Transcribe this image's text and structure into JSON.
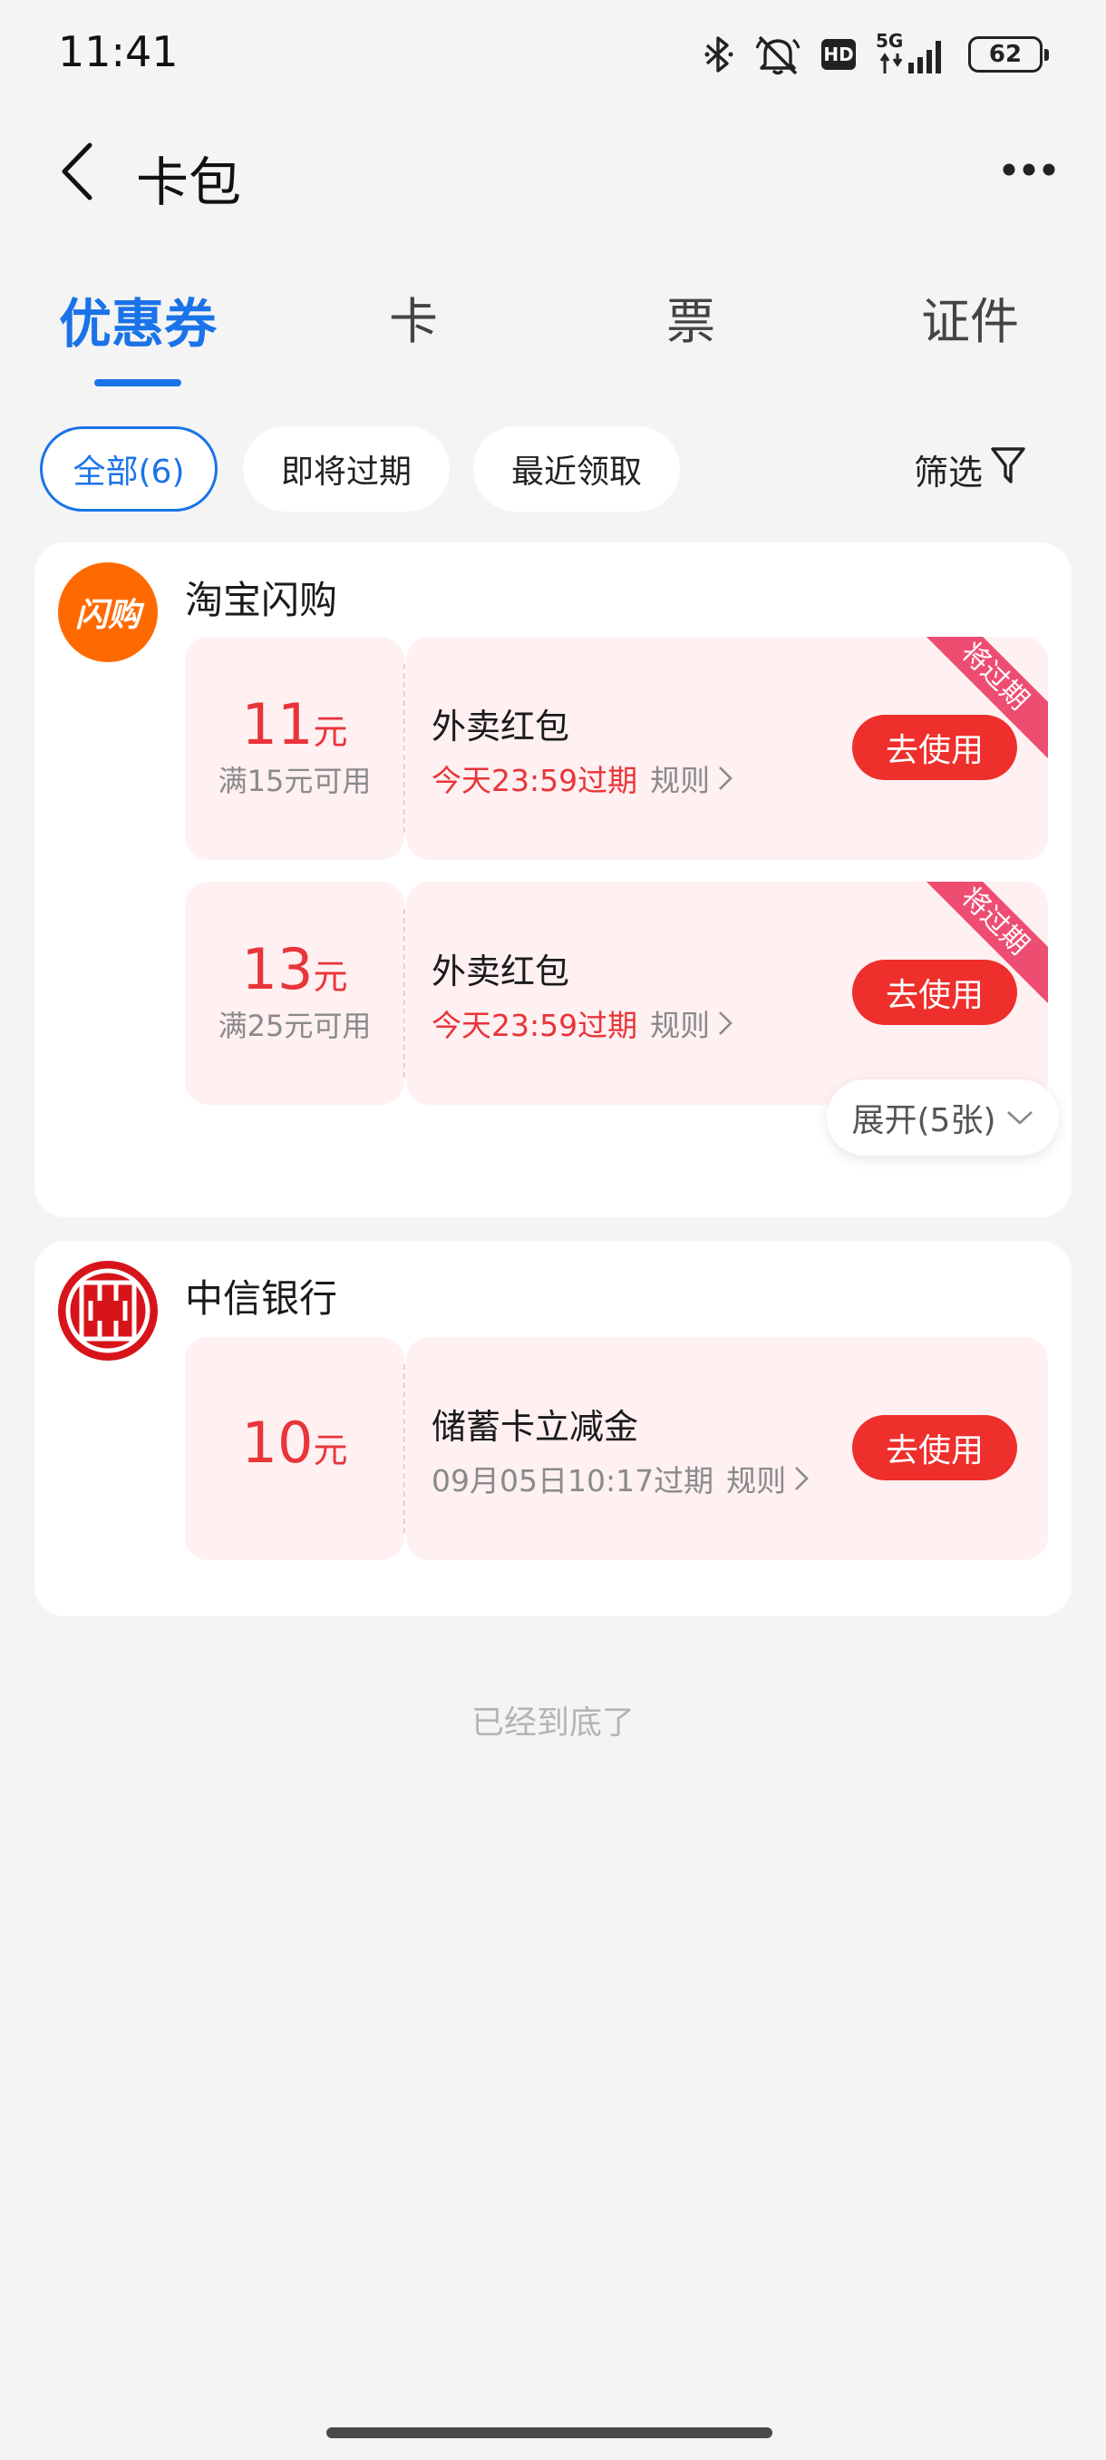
{
  "status_bar": {
    "time": "11:41",
    "network": "5G",
    "hd": "HD",
    "battery": "62"
  },
  "nav": {
    "title": "卡包"
  },
  "tabs": [
    {
      "label": "优惠券",
      "active": true
    },
    {
      "label": "卡",
      "active": false
    },
    {
      "label": "票",
      "active": false
    },
    {
      "label": "证件",
      "active": false
    }
  ],
  "filters": {
    "chips": [
      {
        "label": "全部(6)",
        "active": true
      },
      {
        "label": "即将过期",
        "active": false
      },
      {
        "label": "最近领取",
        "active": false
      }
    ],
    "filter_label": "筛选"
  },
  "merchants": [
    {
      "name": "淘宝闪购",
      "logo_text": "闪购",
      "logo_color": "#ff6a00",
      "coupons": [
        {
          "amount": "11",
          "unit": "元",
          "condition": "满15元可用",
          "title": "外卖红包",
          "expire": "今天23:59过期",
          "rule": "规则",
          "button": "去使用",
          "ribbon": "将过期"
        },
        {
          "amount": "13",
          "unit": "元",
          "condition": "满25元可用",
          "title": "外卖红包",
          "expire": "今天23:59过期",
          "rule": "规则",
          "button": "去使用",
          "ribbon": "将过期"
        }
      ],
      "expand_label": "展开(5张)"
    },
    {
      "name": "中信银行",
      "logo_color": "#d7141a",
      "coupons": [
        {
          "amount": "10",
          "unit": "元",
          "condition": "",
          "title": "储蓄卡立减金",
          "expire": "09月05日10:17过期",
          "rule": "规则",
          "button": "去使用"
        }
      ]
    }
  ],
  "footer": {
    "end_text": "已经到底了"
  },
  "colors": {
    "accent": "#1a73e8",
    "coupon_red": "#e8353a",
    "button_red": "#ee2f2b",
    "ribbon_pink": "#ee4d72",
    "coupon_bg": "#fff0f1"
  }
}
